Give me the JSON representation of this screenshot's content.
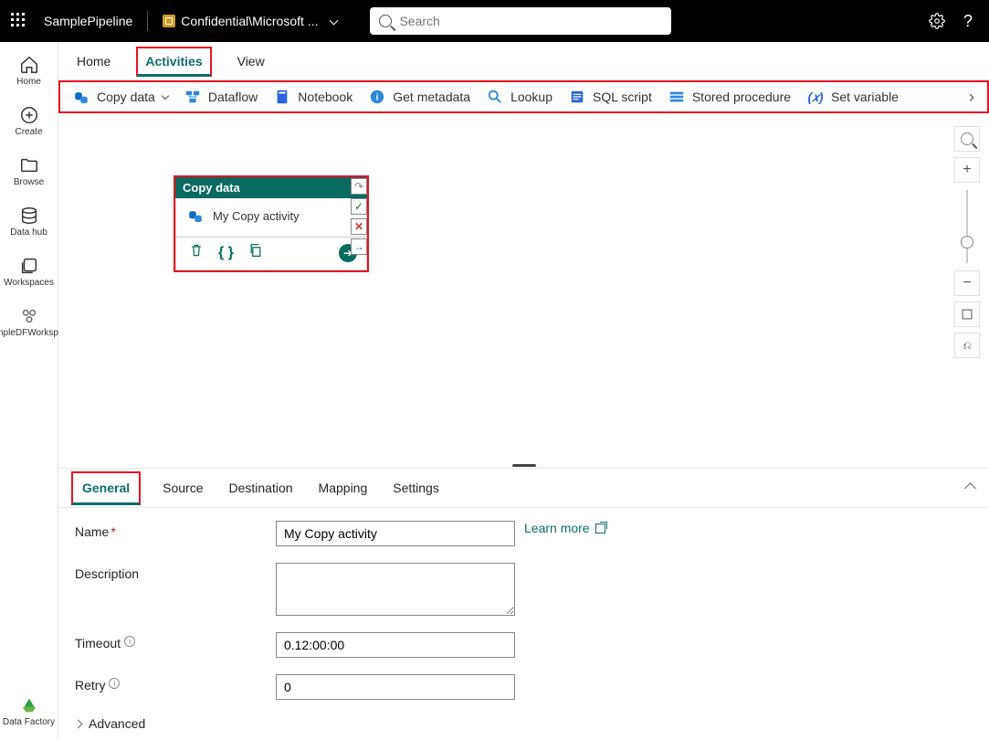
{
  "topbar": {
    "pipeline_name": "SamplePipeline",
    "sensitivity_label": "Confidential\\Microsoft ...",
    "search_placeholder": "Search"
  },
  "leftnav": [
    {
      "label": "Home",
      "icon": "home-icon"
    },
    {
      "label": "Create",
      "icon": "plus-circle-icon"
    },
    {
      "label": "Browse",
      "icon": "folder-icon"
    },
    {
      "label": "Data hub",
      "icon": "database-icon"
    },
    {
      "label": "Workspaces",
      "icon": "stack-icon"
    },
    {
      "label": "SampleDFWorkspace",
      "icon": "workspace-icon"
    }
  ],
  "footer_nav": {
    "label": "Data Factory",
    "icon": "data-factory-icon"
  },
  "tabs": [
    "Home",
    "Activities",
    "View"
  ],
  "active_tab": "Activities",
  "ribbon": [
    {
      "label": "Copy data",
      "icon": "copy-data-icon",
      "dropdown": true
    },
    {
      "label": "Dataflow",
      "icon": "dataflow-icon"
    },
    {
      "label": "Notebook",
      "icon": "notebook-icon"
    },
    {
      "label": "Get metadata",
      "icon": "info-icon"
    },
    {
      "label": "Lookup",
      "icon": "lookup-icon"
    },
    {
      "label": "SQL script",
      "icon": "sql-icon"
    },
    {
      "label": "Stored procedure",
      "icon": "sproc-icon"
    },
    {
      "label": "Set variable",
      "icon": "variable-icon"
    }
  ],
  "activity_card": {
    "header": "Copy data",
    "title": "My Copy activity"
  },
  "bottom_tabs": [
    "General",
    "Source",
    "Destination",
    "Mapping",
    "Settings"
  ],
  "active_bottom_tab": "General",
  "form": {
    "name_label": "Name",
    "name_value": "My Copy activity",
    "learn_more": "Learn more",
    "description_label": "Description",
    "description_value": "",
    "timeout_label": "Timeout",
    "timeout_value": "0.12:00:00",
    "retry_label": "Retry",
    "retry_value": "0",
    "advanced_label": "Advanced"
  }
}
